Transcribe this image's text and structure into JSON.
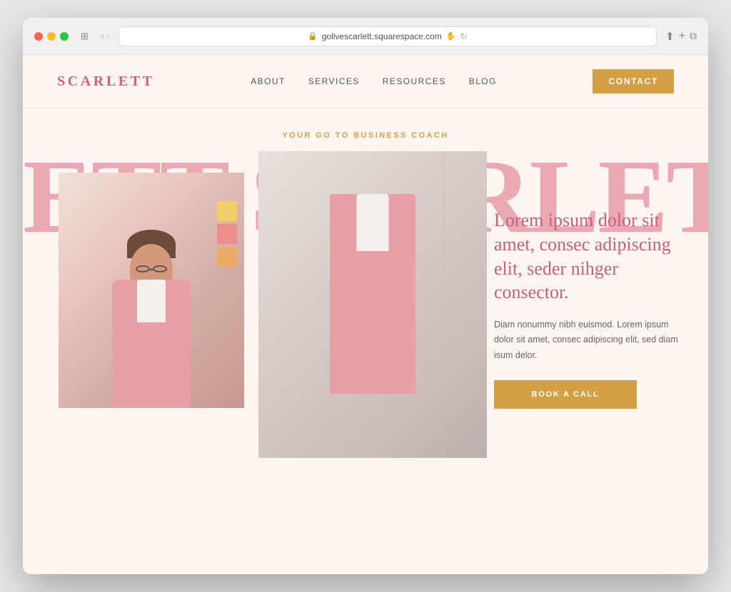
{
  "browser": {
    "url": "golivescarlett.squarespace.com",
    "nav_back": "‹",
    "nav_forward": "›",
    "share_icon": "⬆",
    "new_tab_icon": "+",
    "sidebar_icon": "⧉"
  },
  "header": {
    "logo": "SCARLETT",
    "nav": {
      "about": "ABOUT",
      "services": "SERVICES",
      "resources": "RESOURCES",
      "blog": "BLOG"
    },
    "contact_button": "CONTACT"
  },
  "hero": {
    "tagline": "YOUR GO TO BUSINESS COACH",
    "big_text": "ETT  SCARLET",
    "headline": "Lorem ipsum dolor sit amet, consec adipiscing elit, seder nihger consector.",
    "body_text": "Diam nonummy nibh euismod. Lorem ipsum dolor sit amet, consec adipiscing elit, sed diam isum delor.",
    "cta_button": "BOOK A CALL"
  },
  "colors": {
    "brand_pink": "#d4607a",
    "brand_gold": "#d4a043",
    "bg_cream": "#fdf6f0",
    "text_pink_big": "#e8a0ad",
    "text_dark": "#555555"
  }
}
